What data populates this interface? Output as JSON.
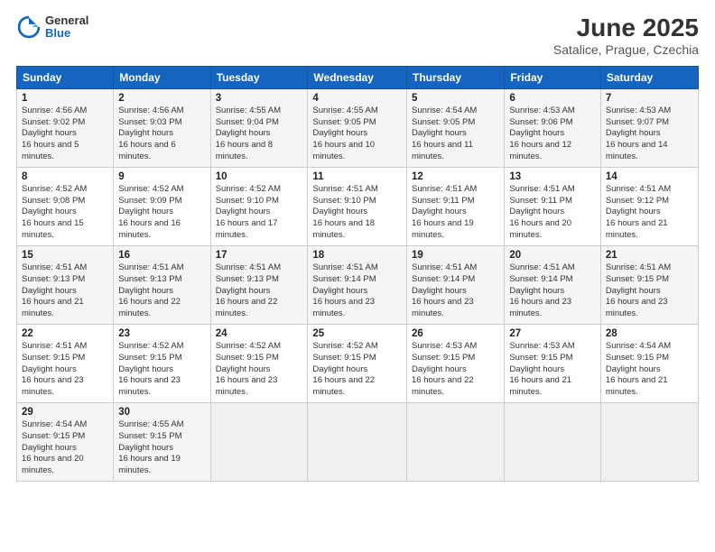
{
  "header": {
    "logo": {
      "general": "General",
      "blue": "Blue"
    },
    "title": "June 2025",
    "subtitle": "Satalice, Prague, Czechia"
  },
  "weekdays": [
    "Sunday",
    "Monday",
    "Tuesday",
    "Wednesday",
    "Thursday",
    "Friday",
    "Saturday"
  ],
  "weeks": [
    [
      {
        "day": 1,
        "sunrise": "4:56 AM",
        "sunset": "9:02 PM",
        "daylight": "16 hours and 5 minutes."
      },
      {
        "day": 2,
        "sunrise": "4:56 AM",
        "sunset": "9:03 PM",
        "daylight": "16 hours and 6 minutes."
      },
      {
        "day": 3,
        "sunrise": "4:55 AM",
        "sunset": "9:04 PM",
        "daylight": "16 hours and 8 minutes."
      },
      {
        "day": 4,
        "sunrise": "4:55 AM",
        "sunset": "9:05 PM",
        "daylight": "16 hours and 10 minutes."
      },
      {
        "day": 5,
        "sunrise": "4:54 AM",
        "sunset": "9:05 PM",
        "daylight": "16 hours and 11 minutes."
      },
      {
        "day": 6,
        "sunrise": "4:53 AM",
        "sunset": "9:06 PM",
        "daylight": "16 hours and 12 minutes."
      },
      {
        "day": 7,
        "sunrise": "4:53 AM",
        "sunset": "9:07 PM",
        "daylight": "16 hours and 14 minutes."
      }
    ],
    [
      {
        "day": 8,
        "sunrise": "4:52 AM",
        "sunset": "9:08 PM",
        "daylight": "16 hours and 15 minutes."
      },
      {
        "day": 9,
        "sunrise": "4:52 AM",
        "sunset": "9:09 PM",
        "daylight": "16 hours and 16 minutes."
      },
      {
        "day": 10,
        "sunrise": "4:52 AM",
        "sunset": "9:10 PM",
        "daylight": "16 hours and 17 minutes."
      },
      {
        "day": 11,
        "sunrise": "4:51 AM",
        "sunset": "9:10 PM",
        "daylight": "16 hours and 18 minutes."
      },
      {
        "day": 12,
        "sunrise": "4:51 AM",
        "sunset": "9:11 PM",
        "daylight": "16 hours and 19 minutes."
      },
      {
        "day": 13,
        "sunrise": "4:51 AM",
        "sunset": "9:11 PM",
        "daylight": "16 hours and 20 minutes."
      },
      {
        "day": 14,
        "sunrise": "4:51 AM",
        "sunset": "9:12 PM",
        "daylight": "16 hours and 21 minutes."
      }
    ],
    [
      {
        "day": 15,
        "sunrise": "4:51 AM",
        "sunset": "9:13 PM",
        "daylight": "16 hours and 21 minutes."
      },
      {
        "day": 16,
        "sunrise": "4:51 AM",
        "sunset": "9:13 PM",
        "daylight": "16 hours and 22 minutes."
      },
      {
        "day": 17,
        "sunrise": "4:51 AM",
        "sunset": "9:13 PM",
        "daylight": "16 hours and 22 minutes."
      },
      {
        "day": 18,
        "sunrise": "4:51 AM",
        "sunset": "9:14 PM",
        "daylight": "16 hours and 23 minutes."
      },
      {
        "day": 19,
        "sunrise": "4:51 AM",
        "sunset": "9:14 PM",
        "daylight": "16 hours and 23 minutes."
      },
      {
        "day": 20,
        "sunrise": "4:51 AM",
        "sunset": "9:14 PM",
        "daylight": "16 hours and 23 minutes."
      },
      {
        "day": 21,
        "sunrise": "4:51 AM",
        "sunset": "9:15 PM",
        "daylight": "16 hours and 23 minutes."
      }
    ],
    [
      {
        "day": 22,
        "sunrise": "4:51 AM",
        "sunset": "9:15 PM",
        "daylight": "16 hours and 23 minutes."
      },
      {
        "day": 23,
        "sunrise": "4:52 AM",
        "sunset": "9:15 PM",
        "daylight": "16 hours and 23 minutes."
      },
      {
        "day": 24,
        "sunrise": "4:52 AM",
        "sunset": "9:15 PM",
        "daylight": "16 hours and 23 minutes."
      },
      {
        "day": 25,
        "sunrise": "4:52 AM",
        "sunset": "9:15 PM",
        "daylight": "16 hours and 22 minutes."
      },
      {
        "day": 26,
        "sunrise": "4:53 AM",
        "sunset": "9:15 PM",
        "daylight": "16 hours and 22 minutes."
      },
      {
        "day": 27,
        "sunrise": "4:53 AM",
        "sunset": "9:15 PM",
        "daylight": "16 hours and 21 minutes."
      },
      {
        "day": 28,
        "sunrise": "4:54 AM",
        "sunset": "9:15 PM",
        "daylight": "16 hours and 21 minutes."
      }
    ],
    [
      {
        "day": 29,
        "sunrise": "4:54 AM",
        "sunset": "9:15 PM",
        "daylight": "16 hours and 20 minutes."
      },
      {
        "day": 30,
        "sunrise": "4:55 AM",
        "sunset": "9:15 PM",
        "daylight": "16 hours and 19 minutes."
      },
      null,
      null,
      null,
      null,
      null
    ]
  ],
  "labels": {
    "sunrise": "Sunrise:",
    "sunset": "Sunset:",
    "daylight": "Daylight hours"
  }
}
